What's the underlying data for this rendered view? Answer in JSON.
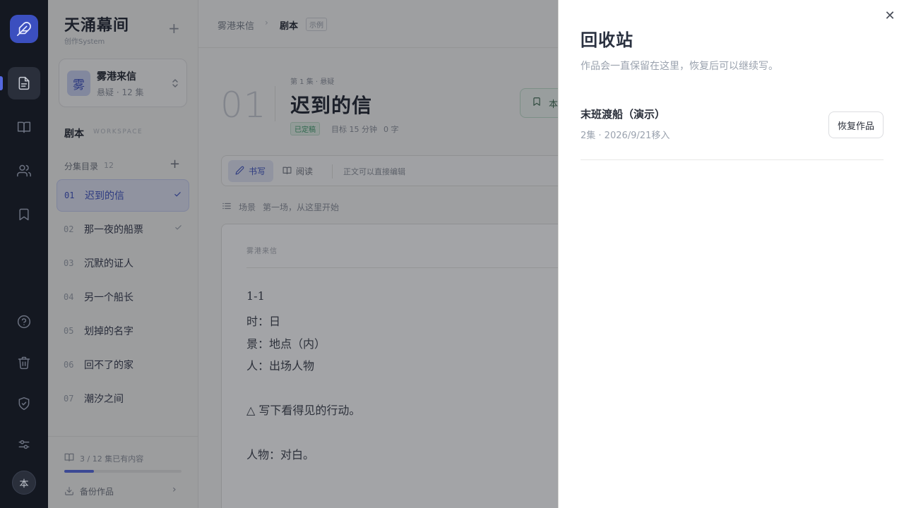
{
  "rail": {
    "avatar_label": "本",
    "icons": [
      "feather-icon",
      "document-icon",
      "book-icon",
      "users-icon",
      "bookmark-icon",
      "help-icon",
      "trash-icon",
      "shield-icon",
      "sliders-icon"
    ],
    "accent": "#3b4fbf"
  },
  "sidebar": {
    "brand_title": "天涌幕间",
    "brand_subtitle": "创作System",
    "project": {
      "avatar": "雾",
      "name": "雾港来信",
      "meta": "悬疑 · 12 集"
    },
    "workspace_label": "剧本",
    "workspace_en": "WORKSPACE",
    "episodes_header": "分集目录",
    "episodes_count": "12",
    "episodes": [
      {
        "num": "01",
        "title": "迟到的信",
        "active": true,
        "done": true
      },
      {
        "num": "02",
        "title": "那一夜的船票",
        "active": false,
        "done": true
      },
      {
        "num": "03",
        "title": "沉默的证人",
        "active": false,
        "done": false
      },
      {
        "num": "04",
        "title": "另一个船长",
        "active": false,
        "done": false
      },
      {
        "num": "05",
        "title": "划掉的名字",
        "active": false,
        "done": false
      },
      {
        "num": "06",
        "title": "回不了的家",
        "active": false,
        "done": false
      },
      {
        "num": "07",
        "title": "潮汐之间",
        "active": false,
        "done": false
      }
    ],
    "progress_text": "3 / 12 集已有内容",
    "progress_fraction": 0.25,
    "backup_label": "备份作品"
  },
  "main": {
    "breadcrumb_project": "雾港来信",
    "breadcrumb_current": "剧本",
    "breadcrumb_badge": "示例",
    "episode_number": "01",
    "episode_kicker": "第 1 集 · 悬疑",
    "episode_title": "迟到的信",
    "status_badge": "已定稿",
    "target_text": "目标 15 分钟",
    "word_count": "0 字",
    "mark_button_label": "本",
    "tool_write": "书写",
    "tool_read": "阅读",
    "tool_hint": "正文可以直接编辑",
    "scene_label": "场景",
    "scene_placeholder": "第一场，从这里开始",
    "page_header": "雾港来信",
    "script_lines": [
      "1-1",
      "时：日",
      "景：地点（内）",
      "人：出场人物",
      "△ 写下看得见的行动。",
      "人物：对白。"
    ]
  },
  "drawer": {
    "title": "回收站",
    "subtitle": "作品会一直保留在这里，恢复后可以继续写。",
    "items": [
      {
        "name": "末班渡船（演示）",
        "meta": "2集 · 2026/9/21移入",
        "action": "恢复作品"
      }
    ]
  }
}
